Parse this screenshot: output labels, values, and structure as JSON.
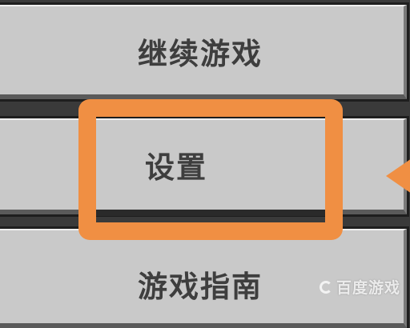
{
  "menu": {
    "items": [
      {
        "label": "继续游戏"
      },
      {
        "label": "设置"
      },
      {
        "label": "游戏指南"
      }
    ]
  },
  "highlight": {
    "color": "#f08f43"
  },
  "watermark": {
    "text": "百度游戏",
    "icon": "baidu-game-logo-icon"
  }
}
